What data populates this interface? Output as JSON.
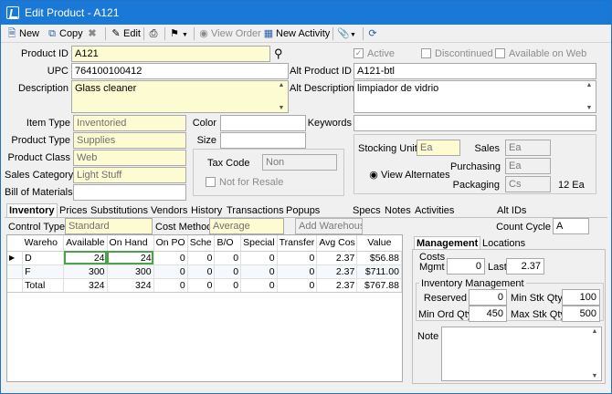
{
  "window": {
    "title": "Edit Product - A121"
  },
  "toolbar": {
    "new_label": "New",
    "copy_label": "Copy",
    "edit_label": "Edit",
    "view_order_label": "View Order",
    "new_activity_label": "New Activity"
  },
  "form": {
    "product_id_label": "Product ID",
    "product_id": "A121",
    "upc_label": "UPC",
    "upc": "764100100412",
    "description_label": "Description",
    "description": "Glass cleaner",
    "item_type_label": "Item Type",
    "item_type": "Inventoried",
    "product_type_label": "Product Type",
    "product_type": "Supplies",
    "product_class_label": "Product Class",
    "product_class": "Web",
    "sales_category_label": "Sales Category",
    "sales_category": "Light Stuff",
    "bom_label": "Bill of Materials",
    "bom": "",
    "color_label": "Color",
    "color": "",
    "size_label": "Size",
    "size": "",
    "tax_code_label": "Tax Code",
    "tax_code": "Non",
    "not_for_resale_label": "Not for Resale",
    "active_label": "Active",
    "discontinued_label": "Discontinued",
    "available_on_web_label": "Available on Web",
    "alt_product_id_label": "Alt Product ID",
    "alt_product_id": "A121-btl",
    "alt_description_label": "Alt Description",
    "alt_description": "limpiador de vidrio",
    "keywords_label": "Keywords",
    "keywords": "",
    "stocking_unit_label": "Stocking Unit",
    "stocking_unit": "Ea",
    "view_alternates_label": "View Alternates",
    "sales_label": "Sales",
    "sales": "Ea",
    "purchasing_label": "Purchasing",
    "purchasing": "Ea",
    "packaging_label": "Packaging",
    "packaging": "Cs",
    "packaging_qty": "12 Ea"
  },
  "tabs": [
    "Inventory",
    "Prices",
    "Substitutions",
    "Vendors",
    "History",
    "Transactions",
    "Popups",
    "Specs",
    "Notes",
    "Activities",
    "Alt IDs"
  ],
  "inventory": {
    "control_type_label": "Control Type",
    "control_type": "Standard",
    "cost_method_label": "Cost Method",
    "cost_method": "Average",
    "add_warehouse_label": "Add Warehouse",
    "count_cycle_label": "Count Cycle",
    "count_cycle": "A",
    "columns": [
      "Wareho",
      "Available",
      "On Hand",
      "On PO",
      "Sche",
      "B/O",
      "Special",
      "Transfer",
      "Avg Cos",
      "Value"
    ],
    "rows": [
      [
        "D",
        "24",
        "24",
        "0",
        "0",
        "0",
        "0",
        "0",
        "2.37",
        "$56.88"
      ],
      [
        "F",
        "300",
        "300",
        "0",
        "0",
        "0",
        "0",
        "0",
        "2.37",
        "$711.00"
      ],
      [
        "Total",
        "324",
        "324",
        "0",
        "0",
        "0",
        "0",
        "0",
        "2.37",
        "$767.88"
      ]
    ]
  },
  "right_panel": {
    "tabs": [
      "Management",
      "Locations"
    ],
    "costs_title": "Costs",
    "mgmt_label": "Mgmt",
    "mgmt": "0",
    "last_label": "Last",
    "last": "2.37",
    "inv_mgmt_title": "Inventory Management",
    "reserved_label": "Reserved",
    "reserved": "0",
    "min_stk_label": "Min Stk Qty",
    "min_stk": "100",
    "min_ord_label": "Min Ord Qty",
    "min_ord": "450",
    "max_stk_label": "Max Stk Qty",
    "max_stk": "500",
    "note_label": "Note",
    "note": ""
  }
}
